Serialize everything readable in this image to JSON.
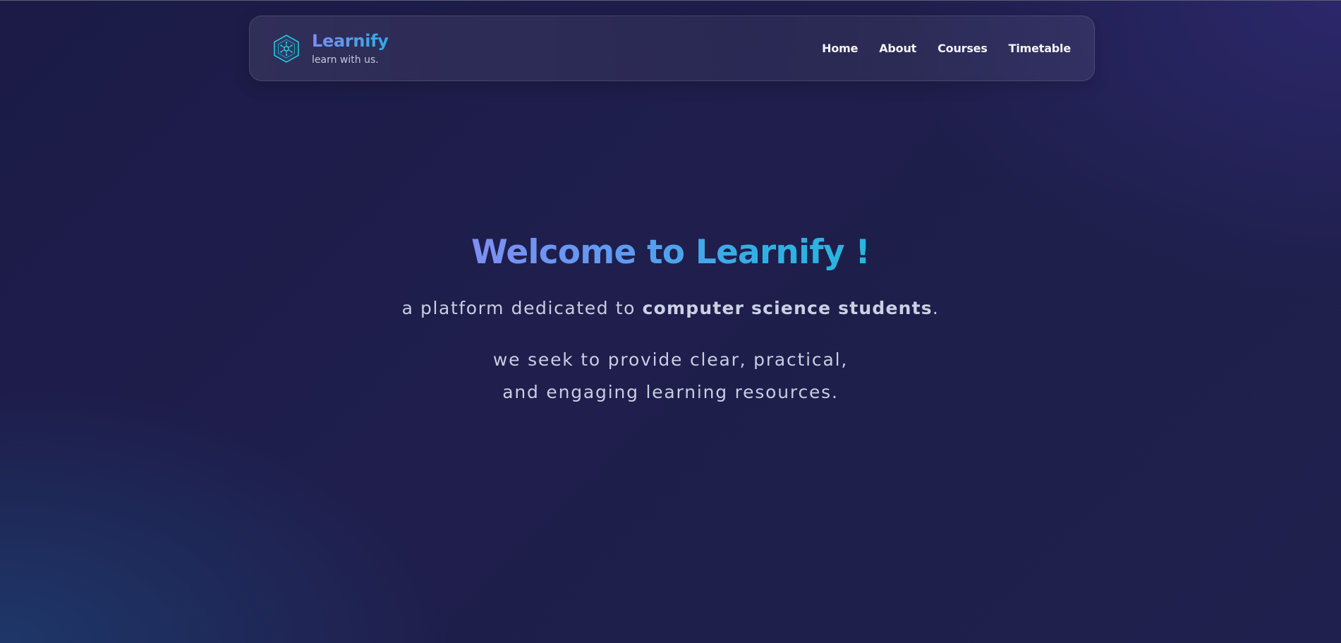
{
  "brand": {
    "name": "Learnify",
    "tagline": "learn with us."
  },
  "nav": {
    "links": [
      {
        "label": "Home"
      },
      {
        "label": "About"
      },
      {
        "label": "Courses"
      },
      {
        "label": "Timetable"
      }
    ]
  },
  "hero": {
    "title": "Welcome to Learnify !",
    "subtitle_prefix": "a platform dedicated to ",
    "subtitle_emphasis": "computer science students",
    "subtitle_suffix": ".",
    "description_line1": "we seek to provide clear, practical,",
    "description_line2": "and engaging learning resources."
  },
  "colors": {
    "accent_start": "#7c8ef2",
    "accent_end": "#27b6de",
    "background": "#1e1d4b",
    "logo_stroke": "#22c6e0"
  },
  "icons": {
    "logo": "hexagon-circuit-icon"
  }
}
